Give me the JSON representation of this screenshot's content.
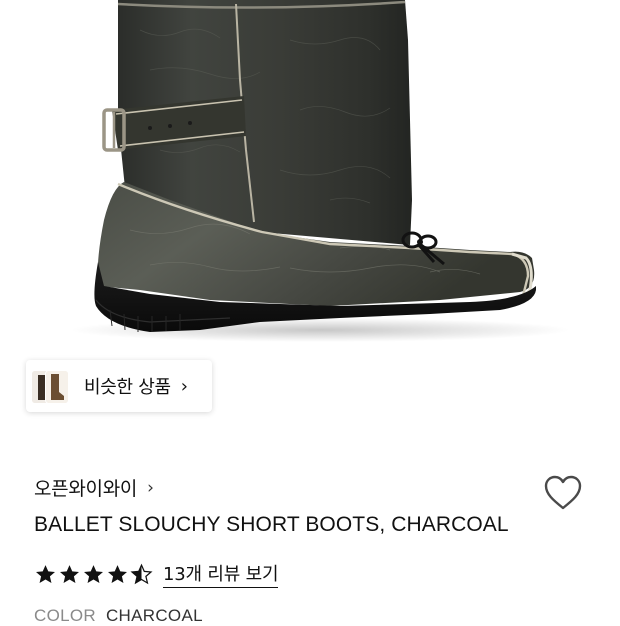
{
  "product": {
    "image_alt": "Charcoal slouchy leather boot with side buckle strap and bow detail",
    "similar": {
      "label": "비슷한 상품",
      "chevron": "›"
    },
    "brand": {
      "name": "오픈와이와이",
      "chevron": "›"
    },
    "wishlist_icon": "heart-outline-icon",
    "title": "BALLET SLOUCHY SHORT BOOTS, CHARCOAL",
    "rating": {
      "stars": 4.5,
      "max": 5,
      "review_link": "13개 리뷰 보기"
    },
    "color": {
      "label": "COLOR",
      "value": "CHARCOAL"
    }
  },
  "colors": {
    "text": "#111111",
    "muted": "#8a8a8a",
    "boot_leather": "#3a3d38",
    "sole": "#111111"
  }
}
